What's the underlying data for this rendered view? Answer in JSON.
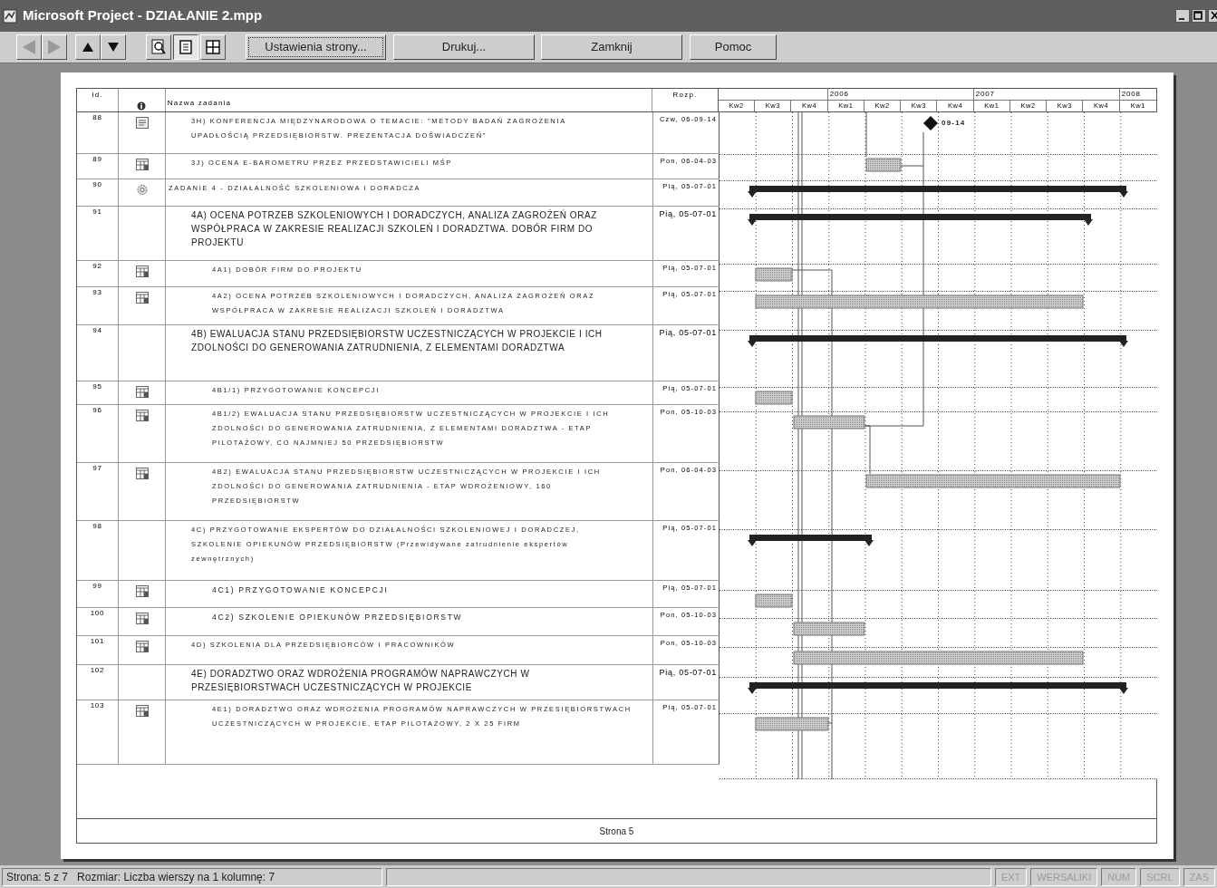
{
  "window": {
    "title": "Microsoft Project - DZIAŁANIE 2.mpp"
  },
  "toolbar": {
    "icons": [
      {
        "kind": "previous",
        "disabled": true
      },
      {
        "kind": "next",
        "disabled": true
      },
      {
        "kind": "up",
        "disabled": false
      },
      {
        "kind": "down",
        "disabled": false
      },
      {
        "kind": "zoom",
        "selected": false
      },
      {
        "kind": "one-page",
        "selected": true
      },
      {
        "kind": "multi-page",
        "selected": false
      }
    ],
    "buttons": [
      {
        "label": "Ustawienia strony...",
        "focused": true
      },
      {
        "label": "Drukuj...",
        "focused": false
      },
      {
        "label": "Zamknij",
        "focused": false
      },
      {
        "label": "Pomoc",
        "focused": false
      }
    ]
  },
  "table": {
    "columns": [
      "Id.",
      "Nazwa zadania",
      "Rozp."
    ],
    "timescale": {
      "years": [
        "2006",
        "2007",
        "2008"
      ],
      "quarters": [
        "Kw2",
        "Kw3",
        "Kw4",
        "Kw1",
        "Kw2",
        "Kw3",
        "Kw4",
        "Kw1",
        "Kw2",
        "Kw3",
        "Kw4",
        "Kw1"
      ]
    },
    "rows": [
      {
        "id": "88",
        "kind": "milestone",
        "name": "3H) KONFERENCJA MIĘDZYNARODOWA O TEMACIE: \"METODY BADAŃ ZAGROŻENIA UPADŁOŚCIĄ PRZEDSIĘBIORSTW. PREZENTACJA DOŚWIADCZEŃ\"",
        "start": "Czw, 06-09-14",
        "bar_label": "09-14"
      },
      {
        "id": "89",
        "kind": "task",
        "name": "3J) OCENA E-BAROMETRU PRZEZ PRZEDSTAWICIELI MŚP",
        "start": "Pon, 06-04-03"
      },
      {
        "id": "90",
        "kind": "root",
        "name": "ZADANIE 4 - DZIAŁALNOŚĆ SZKOLENIOWA I DORADCZA",
        "start": "Pią, 05-07-01",
        "children": [
          {
            "id": "91",
            "kind": "summary",
            "name": "4A) OCENA POTRZEB SZKOLENIOWYCH I DORADCZYCH, ANALIZA ZAGROŻEŃ ORAZ WSPÓŁPRACA W ZAKRESIE REALIZACJI SZKOLEŃ I DORADZTWA. DOBÓR FIRM DO PROJEKTU",
            "start": "Pią, 05-07-01",
            "children": [
              {
                "id": "92",
                "kind": "task",
                "name": "4A1) DOBÓR FIRM DO PROJEKTU",
                "start": "Pią, 05-07-01"
              },
              {
                "id": "93",
                "kind": "task",
                "name": "4A2) OCENA POTRZEB SZKOLENIOWYCH I DORADCZYCH, ANALIZA ZAGROŻEŃ ORAZ WSPÓŁPRACA W ZAKRESIE REALIZACJI SZKOLEŃ I DORADZTWA",
                "start": "Pią, 05-07-01"
              }
            ]
          },
          {
            "id": "94",
            "kind": "summary",
            "name": "4B) EWALUACJA STANU PRZEDSIĘBIORSTW UCZESTNICZĄCYCH W PROJEKCIE I ICH ZDOLNOŚCI DO GENEROWANIA ZATRUDNIENIA, Z ELEMENTAMI DORADZTWA",
            "start": "Pią, 05-07-01",
            "children": [
              {
                "id": "95",
                "kind": "task",
                "name": "4B1/1) PRZYGOTOWANIE KONCEPCJI",
                "start": "Pią, 05-07-01"
              },
              {
                "id": "96",
                "kind": "task",
                "name": "4B1/2) EWALUACJA STANU PRZEDSIĘBIORSTW UCZESTNICZĄCYCH W PROJEKCIE I ICH ZDOLNOŚCI DO GENEROWANIA ZATRUDNIENIA, Z ELEMENTAMI DORADZTWA - ETAP PILOTAŻOWY, CO NAJMNIEJ 50 PRZEDSIĘBIORSTW",
                "start": "Pon, 05-10-03"
              },
              {
                "id": "97",
                "kind": "task",
                "name": "4B2) EWALUACJA STANU PRZEDSIĘBIORSTW UCZESTNICZĄCYCH W PROJEKCIE I ICH ZDOLNOŚCI DO GENEROWANIA ZATRUDNIENIA - ETAP WDROŻENIOWY, 160 PRZEDSIĘBIORSTW",
                "start": "Pon, 06-04-03"
              }
            ]
          },
          {
            "id": "98",
            "kind": "summary",
            "name": "4C) PRZYGOTOWANIE EKSPERTÓW DO DZIAŁALNOŚCI SZKOLENIOWEJ I DORADCZEJ, SZKOLENIE OPIEKUNÓW PRZEDSIĘBIORSTW (Przewidywane zatrudnienie ekspertów zewnętrznych)",
            "start": "Pią, 05-07-01",
            "children": [
              {
                "id": "99",
                "kind": "task",
                "name": "4C1) PRZYGOTOWANIE KONCEPCJI",
                "start": "Pią, 05-07-01"
              },
              {
                "id": "100",
                "kind": "task",
                "name": "4C2) SZKOLENIE OPIEKUNÓW PRZEDSIĘBIORSTW",
                "start": "Pon, 05-10-03"
              }
            ]
          },
          {
            "id": "101",
            "kind": "task",
            "name": "4D) SZKOLENIA DLA PRZEDSIĘBIORCÓW I PRACOWNIKÓW",
            "start": "Pon, 05-10-03"
          },
          {
            "id": "102",
            "kind": "summary",
            "name": "4E) DORADZTWO ORAZ WDROŻENIA PROGRAMÓW NAPRAWCZYCH W PRZESIĘBIORSTWACH UCZESTNICZĄCYCH W PROJEKCIE",
            "start": "Pią, 05-07-01",
            "children": [
              {
                "id": "103",
                "kind": "task",
                "name": "4E1) DORADZTWO ORAZ WDROŻENIA PROGRAMÓW NAPRAWCZYCH W PRZESIĘBIORSTWACH UCZESTNICZĄCYCH W PROJEKCIE, ETAP PILOTAŻOWY, 2 X 25 FIRM",
                "start": "Pią, 05-07-01"
              }
            ]
          }
        ]
      }
    ]
  },
  "footer": "Strona 5",
  "status_bar": {
    "text": "Strona: 5 z 7   Rozmiar: Liczba wierszy na 1 kolumnę: 7",
    "indicators": [
      {
        "label": "EXT",
        "disabled": true
      },
      {
        "label": "WERSALIKI",
        "disabled": true
      },
      {
        "label": "NUM",
        "disabled": true
      },
      {
        "label": "SCRL",
        "disabled": true
      },
      {
        "label": "ZAS",
        "disabled": true
      }
    ]
  }
}
